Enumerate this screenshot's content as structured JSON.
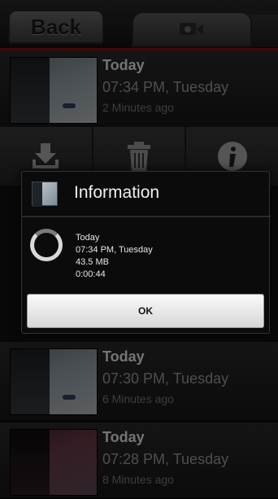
{
  "header": {
    "back_label": "Back",
    "tab_icon": "video-camera-icon"
  },
  "recordings": [
    {
      "date": "Today",
      "time": "07:34 PM, Tuesday",
      "ago": "2 Minutes ago"
    },
    {
      "date": "Today",
      "time": "07:30 PM, Tuesday",
      "ago": "6 Minutes ago"
    },
    {
      "date": "Today",
      "time": "07:28 PM, Tuesday",
      "ago": "8 Minutes ago"
    }
  ],
  "action_bar": {
    "download_icon": "download-icon",
    "delete_icon": "trash-icon",
    "info_icon": "info-icon"
  },
  "dialog": {
    "title": "Information",
    "date": "Today",
    "time": "07:34 PM, Tuesday",
    "size": "43.5 MB",
    "duration": "0:00:44",
    "ok_label": "OK"
  },
  "colors": {
    "accent_red": "#8b1010",
    "background": "#111111"
  }
}
